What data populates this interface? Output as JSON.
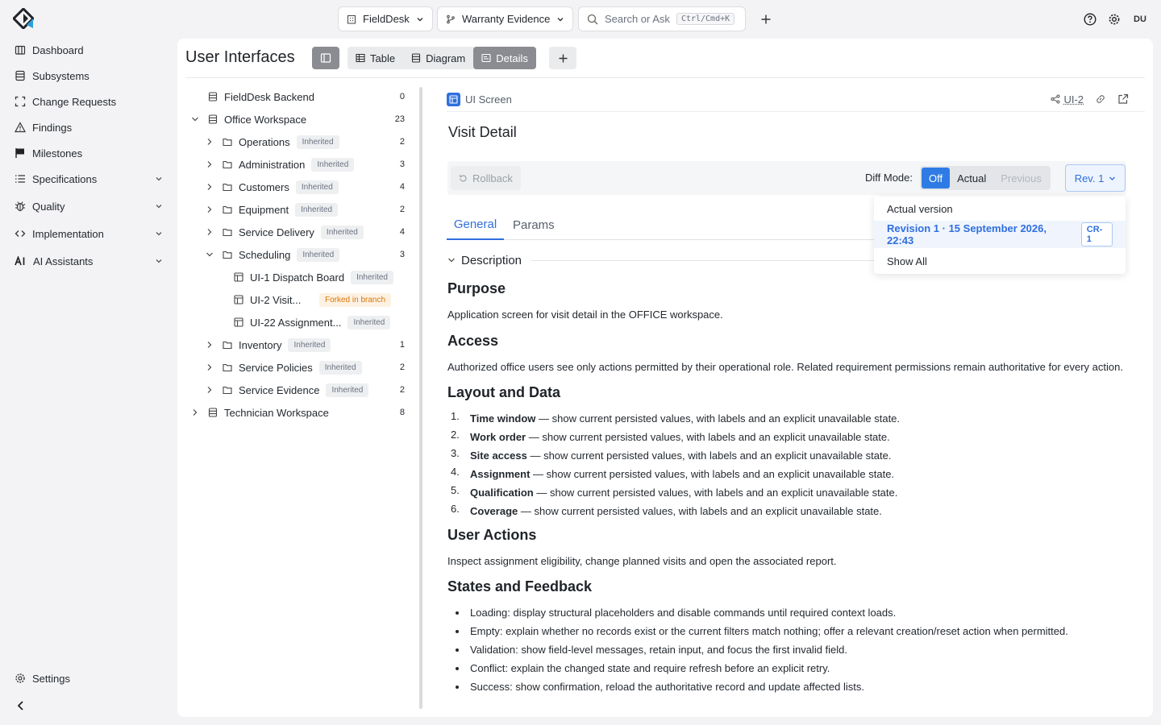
{
  "topbar": {
    "project": "FieldDesk",
    "branch": "Warranty Evidence",
    "search_placeholder": "Search or Ask",
    "search_shortcut": "Ctrl/Cmd+K",
    "avatar": "DU"
  },
  "sidebar": {
    "items": [
      {
        "label": "Dashboard",
        "icon": "dashboard-icon"
      },
      {
        "label": "Subsystems",
        "icon": "database-icon"
      },
      {
        "label": "Change Requests",
        "icon": "frame-icon"
      },
      {
        "label": "Findings",
        "icon": "warning-icon"
      },
      {
        "label": "Milestones",
        "icon": "flag-icon"
      },
      {
        "label": "Specifications",
        "icon": "list-icon"
      },
      {
        "label": "Quality",
        "icon": "bug-icon"
      },
      {
        "label": "Implementation",
        "icon": "code-icon"
      },
      {
        "label": "AI Assistants",
        "icon": "ai-icon"
      }
    ],
    "settings": "Settings"
  },
  "main": {
    "title": "User Interfaces",
    "view_tabs": [
      "Table",
      "Diagram",
      "Details"
    ],
    "active_view": "Details"
  },
  "tree": [
    {
      "label": "FieldDesk Backend",
      "count": "0"
    },
    {
      "label": "Office Workspace",
      "count": "23"
    },
    {
      "label": "Operations",
      "badge": "Inherited",
      "count": "2"
    },
    {
      "label": "Administration",
      "badge": "Inherited",
      "count": "3"
    },
    {
      "label": "Customers",
      "badge": "Inherited",
      "count": "4"
    },
    {
      "label": "Equipment",
      "badge": "Inherited",
      "count": "2"
    },
    {
      "label": "Service Delivery",
      "badge": "Inherited",
      "count": "4"
    },
    {
      "label": "Scheduling",
      "badge": "Inherited",
      "count": "3"
    },
    {
      "label": "UI-1 Dispatch Board",
      "badge": "Inherited"
    },
    {
      "label": "UI-2 Visit...",
      "badge": "Forked in branch"
    },
    {
      "label": "UI-22 Assignment...",
      "badge": "Inherited"
    },
    {
      "label": "Inventory",
      "badge": "Inherited",
      "count": "1"
    },
    {
      "label": "Service Policies",
      "badge": "Inherited",
      "count": "2"
    },
    {
      "label": "Service Evidence",
      "badge": "Inherited",
      "count": "2"
    },
    {
      "label": "Technician Workspace",
      "count": "8"
    }
  ],
  "detail": {
    "type_label": "UI Screen",
    "id": "UI-2",
    "title": "Visit Detail",
    "rollback": "Rollback",
    "diff_label": "Diff Mode:",
    "diff_options": [
      "Off",
      "Actual",
      "Previous"
    ],
    "diff_active": "Off",
    "revision": "Rev. 1",
    "tabs": [
      "General",
      "Params"
    ],
    "section": "Description",
    "doc": {
      "purpose_h": "Purpose",
      "purpose": "Application screen for visit detail in the OFFICE workspace.",
      "access_h": "Access",
      "access": "Authorized office users see only actions permitted by their operational role. Related requirement permissions remain authoritative for every action.",
      "layout_h": "Layout and Data",
      "layout_items": [
        {
          "term": "Time window",
          "text": " — show current persisted values, with labels and an explicit unavailable state."
        },
        {
          "term": "Work order",
          "text": " — show current persisted values, with labels and an explicit unavailable state."
        },
        {
          "term": "Site access",
          "text": " — show current persisted values, with labels and an explicit unavailable state."
        },
        {
          "term": "Assignment",
          "text": " — show current persisted values, with labels and an explicit unavailable state."
        },
        {
          "term": "Qualification",
          "text": " — show current persisted values, with labels and an explicit unavailable state."
        },
        {
          "term": "Coverage",
          "text": " — show current persisted values, with labels and an explicit unavailable state."
        }
      ],
      "actions_h": "User Actions",
      "actions": "Inspect assignment eligibility, change planned visits and open the associated report.",
      "states_h": "States and Feedback",
      "states": [
        "Loading: display structural placeholders and disable commands until required context loads.",
        "Empty: explain whether no records exist or the current filters match nothing; offer a relevant creation/reset action when permitted.",
        "Validation: show field-level messages, retain input, and focus the first invalid field.",
        "Conflict: explain the changed state and require refresh before an explicit retry.",
        "Success: show confirmation, reload the authoritative record and update affected lists."
      ]
    }
  },
  "revision_dropdown": {
    "actual": "Actual version",
    "revision": "Revision 1 · 15 September 2026, 22:43",
    "revision_tag": "CR-1",
    "show_all": "Show All"
  },
  "colors": {
    "accent": "#2f6fde",
    "fork": "#d97706"
  }
}
